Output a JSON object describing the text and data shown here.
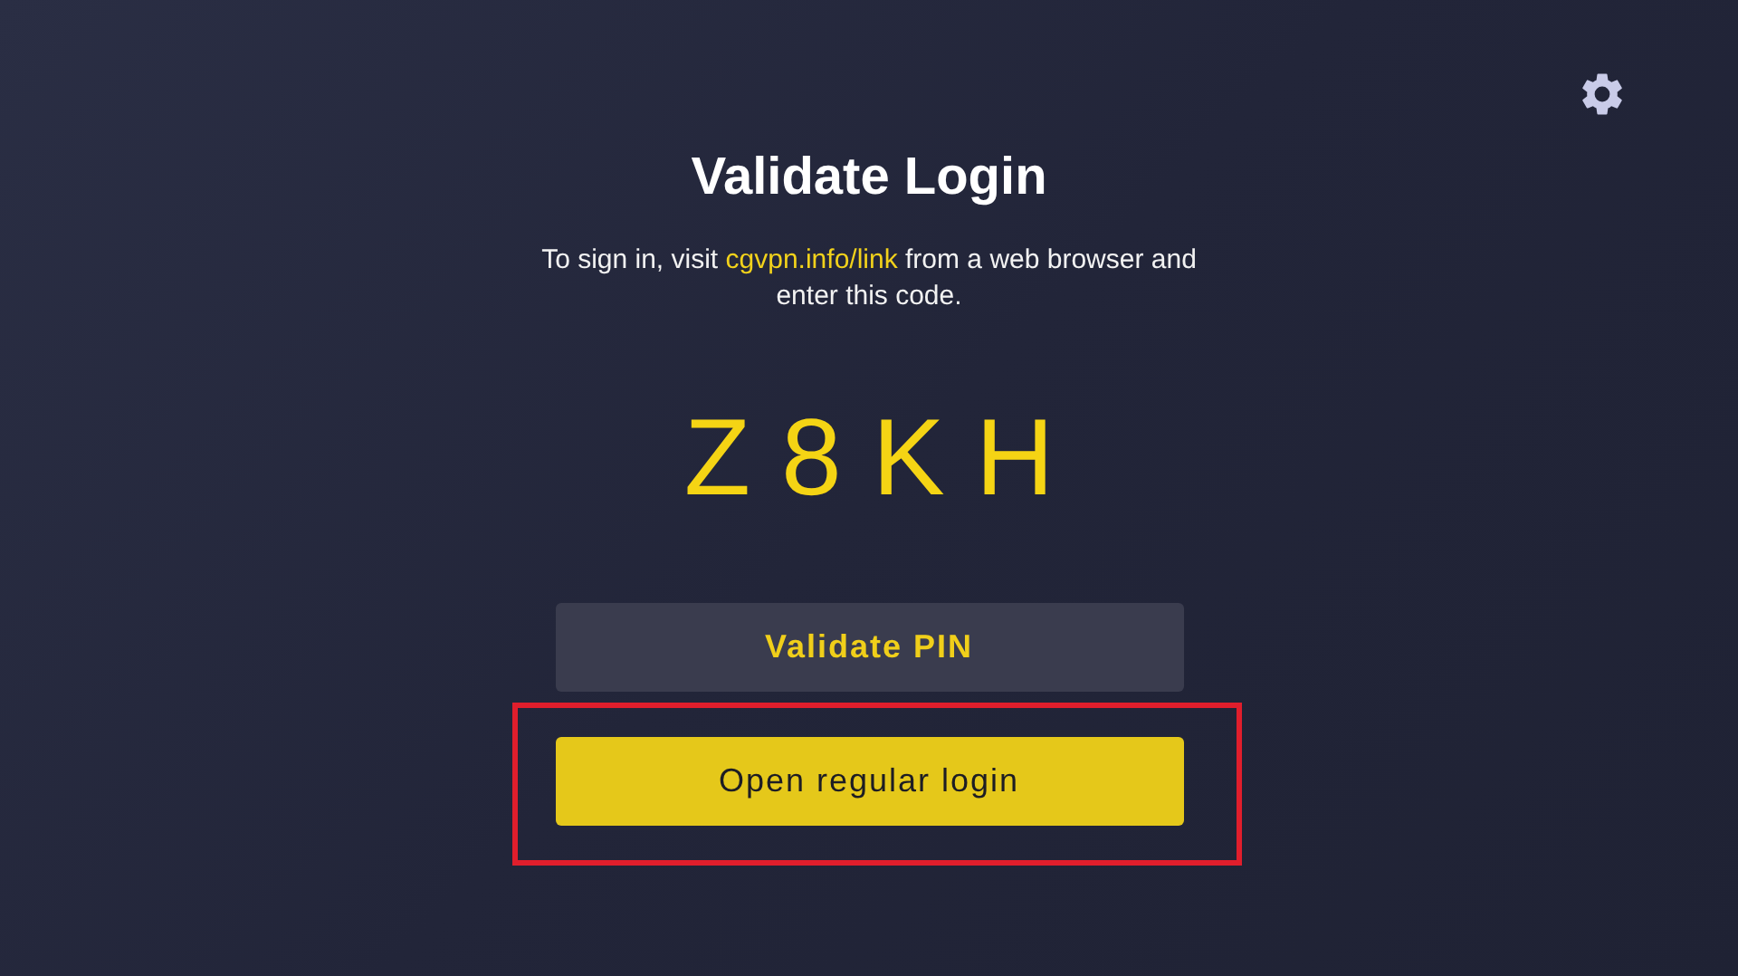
{
  "title": "Validate Login",
  "instructions": {
    "before": "To sign in, visit ",
    "link": "cgvpn.info/link",
    "after": " from a web browser and enter this code."
  },
  "code": "Z8KH",
  "buttons": [
    {
      "label": "Validate PIN",
      "kind": "secondary",
      "highlighted": false
    },
    {
      "label": "Open regular login",
      "kind": "primary",
      "highlighted": true
    }
  ]
}
